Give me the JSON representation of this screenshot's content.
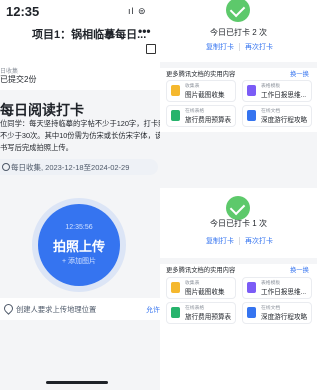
{
  "status_bar": {
    "time": "12:35",
    "icons": "ıl ⊜"
  },
  "nav": {
    "title": "项目1：锅相临摹每日...",
    "more": "•••",
    "share_icon": "share-icon"
  },
  "task": {
    "sub_label": "日收集",
    "submitted": "已提交2份",
    "title": "每日阅读打卡",
    "description_lines": [
      "位同学：每天坚持临摹的字帖不少于120字，打卡照",
      "不少于30次。其中10份需为仿宋或长仿宋字体，该",
      "书写后完成拍照上传。"
    ],
    "date_range": "每日收集, 2023-12-18至2024-02-29"
  },
  "capture_button": {
    "time": "12:35:56",
    "label": "拍照上传",
    "sub": "+ 添加图片"
  },
  "location": {
    "text": "创建人要求上传地理位置",
    "action": "允许"
  },
  "right": {
    "sections": [
      {
        "done_text": "今日已打卡 2 次",
        "copy_label": "复制打卡",
        "again_label": "再次打卡",
        "more_heading": "更多腾讯文档的实用内容",
        "switch_label": "换一换",
        "cards": [
          {
            "sub": "收集表",
            "title": "图片截图收集",
            "color": "#f5b82e"
          },
          {
            "sub": "表格模板",
            "title": "工作日报思维...",
            "color": "#7b5cf6"
          },
          {
            "sub": "在线表格",
            "title": "旅行费用预算表",
            "color": "#26b36c"
          },
          {
            "sub": "在线文档",
            "title": "深度游行程攻略",
            "color": "#3574f0"
          }
        ]
      },
      {
        "done_text": "今日已打卡 1 次",
        "copy_label": "复制打卡",
        "again_label": "再次打卡",
        "more_heading": "更多腾讯文档的实用内容",
        "switch_label": "换一换",
        "cards": [
          {
            "sub": "收集表",
            "title": "图片截图收集",
            "color": "#f5b82e"
          },
          {
            "sub": "表格模板",
            "title": "工作日报思维...",
            "color": "#7b5cf6"
          },
          {
            "sub": "在线表格",
            "title": "旅行费用预算表",
            "color": "#26b36c"
          },
          {
            "sub": "在线文档",
            "title": "深度游行程攻略",
            "color": "#3574f0"
          }
        ]
      }
    ]
  },
  "colors": {
    "accent": "#3574f0",
    "success": "#5dc96b",
    "page_bg": "#f4f5f7"
  }
}
